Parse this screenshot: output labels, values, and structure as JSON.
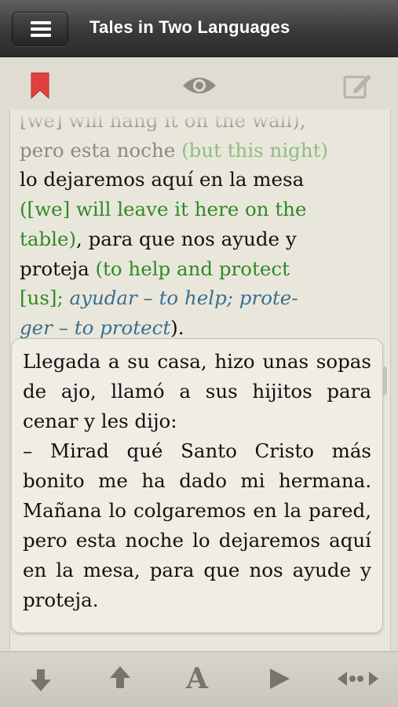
{
  "navbar": {
    "title": "Tales in Two Languages",
    "menu_icon": "hamburger-menu-icon"
  },
  "toolbar": {
    "icons": [
      "bookmark-icon",
      "eye-icon",
      "edit-note-icon"
    ],
    "bookmark_color": "#e0413f"
  },
  "reader": {
    "partial_line": "[we] will hang it on the wall),",
    "line1_es": "pero esta noche ",
    "line1_en": "(but this night)",
    "line2_es": "lo dejaremos aquí en la mesa",
    "line3_en": "([we] will leave it here on the",
    "line4_en": "table)",
    "line4_es": ", para que nos ayude y",
    "line5_es": "proteja ",
    "line5_en": "(to help and protect",
    "line6_en": "[us]; ",
    "line6_note": "ayudar – to help; prote-",
    "line7_note": "ger – to protect",
    "line7_end": ")."
  },
  "card": {
    "para1": "Llegada a su casa, hizo unas sopas de ajo, llamó a sus hijitos para cenar y les dijo:",
    "para2": "– Mirad qué Santo Cristo más bonito me ha dado mi hermana. Mañana lo colgaremos en la pared, pero esta noche lo dejaremos aquí en la mesa, para que nos ayude y proteja."
  },
  "bottom_toolbar": {
    "icons": [
      "arrow-down-icon",
      "arrow-up-icon",
      "font-size-icon",
      "play-icon",
      "navigate-icon"
    ],
    "font_glyph": "A"
  },
  "colors": {
    "english": "#2f8a25",
    "note": "#3b6f8f"
  }
}
